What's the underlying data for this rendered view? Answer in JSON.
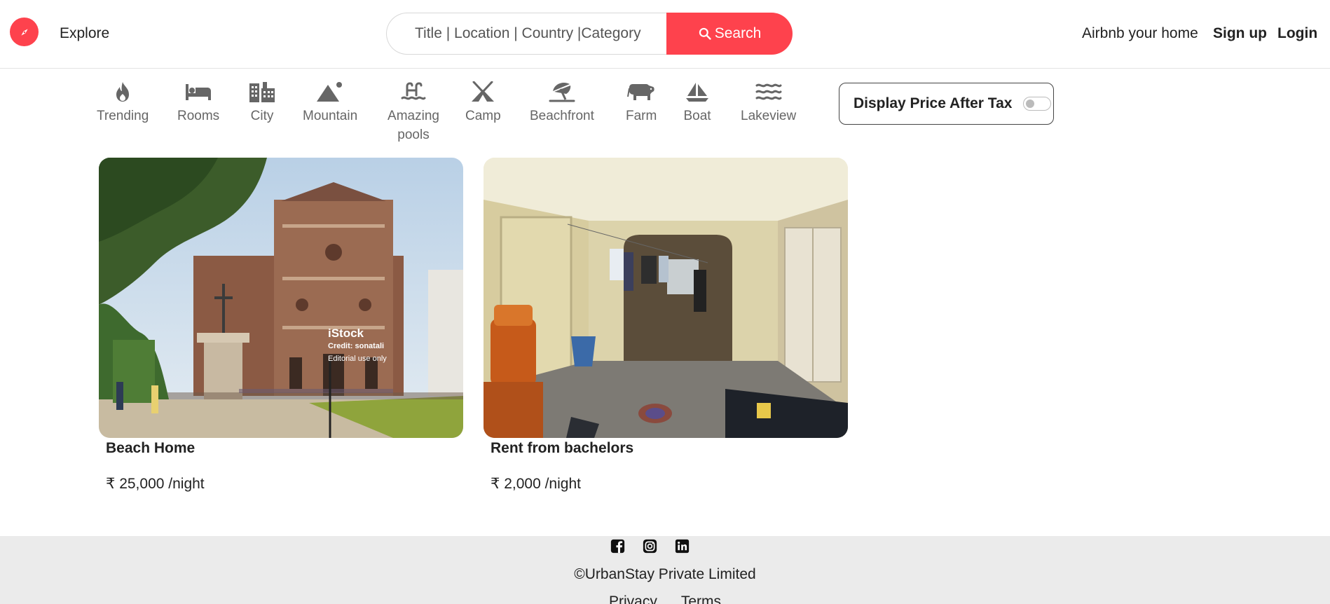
{
  "nav": {
    "explore_label": "Explore",
    "search": {
      "placeholder": "Title | Location | Country |Category",
      "button_label": "Search"
    },
    "host_label": "Airbnb your home",
    "signup_label": "Sign up",
    "login_label": "Login"
  },
  "filters": {
    "items": [
      {
        "label": "Trending",
        "icon": "fire-icon"
      },
      {
        "label": "Rooms",
        "icon": "bed-icon"
      },
      {
        "label": "City",
        "icon": "city-icon"
      },
      {
        "label": "Mountain",
        "icon": "mountain-icon"
      },
      {
        "label": "Amazing pools",
        "icon": "pool-icon"
      },
      {
        "label": "Camp",
        "icon": "campground-icon"
      },
      {
        "label": "Beachfront",
        "icon": "umbrella-beach-icon"
      },
      {
        "label": "Farm",
        "icon": "cow-icon"
      },
      {
        "label": "Boat",
        "icon": "sailboat-icon"
      },
      {
        "label": "Lakeview",
        "icon": "water-icon"
      }
    ],
    "tax_toggle_label": "Display Price After Tax",
    "tax_toggle_on": false
  },
  "listings": [
    {
      "title": "Beach Home",
      "price": "₹ 25,000 /night",
      "watermark": {
        "brand": "iStock",
        "credit": "Credit: sonatali",
        "note": "Editorial use only"
      }
    },
    {
      "title": "Rent from bachelors",
      "price": "₹ 2,000 /night"
    }
  ],
  "footer": {
    "socials": [
      "facebook-icon",
      "instagram-icon",
      "linkedin-icon"
    ],
    "copyright": "©UrbanStay Private Limited",
    "links": [
      "Privacy",
      "Terms"
    ]
  },
  "colors": {
    "brand": "#fe424d",
    "footer_bg": "#ebebeb",
    "text": "#222222",
    "muted": "#666666"
  }
}
